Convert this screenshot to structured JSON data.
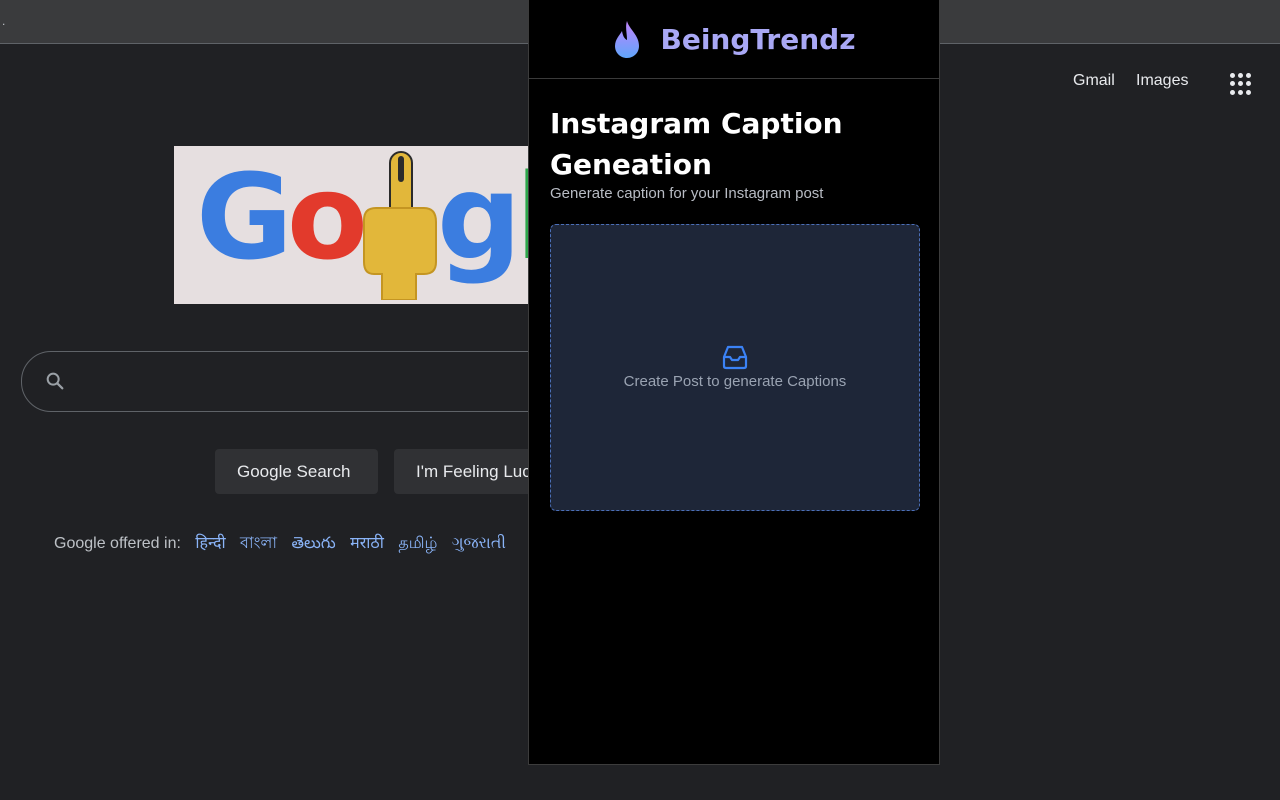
{
  "google": {
    "header": {
      "gmail": "Gmail",
      "images": "Images"
    },
    "buttons": {
      "search": "Google Search",
      "lucky": "I'm Feeling Lucky"
    },
    "offered_label": "Google offered in:",
    "languages": [
      "हिन्दी",
      "বাংলা",
      "తెలుగు",
      "मराठी",
      "தமிழ்",
      "ગુજરાતી"
    ]
  },
  "popup": {
    "brand": "BeingTrendz",
    "title": "Instagram Caption Geneation",
    "subtitle": "Generate caption for your Instagram post",
    "empty_state": "Create Post to generate Captions"
  },
  "colors": {
    "brand_gradient_start": "#a78bfa",
    "brand_gradient_end": "#60a5fa",
    "dropzone_bg": "#1e2638",
    "link": "#8ab4f8"
  },
  "icons": {
    "flame": "flame-icon",
    "inbox": "inbox-icon",
    "search": "search-icon",
    "apps": "apps-grid-icon"
  }
}
